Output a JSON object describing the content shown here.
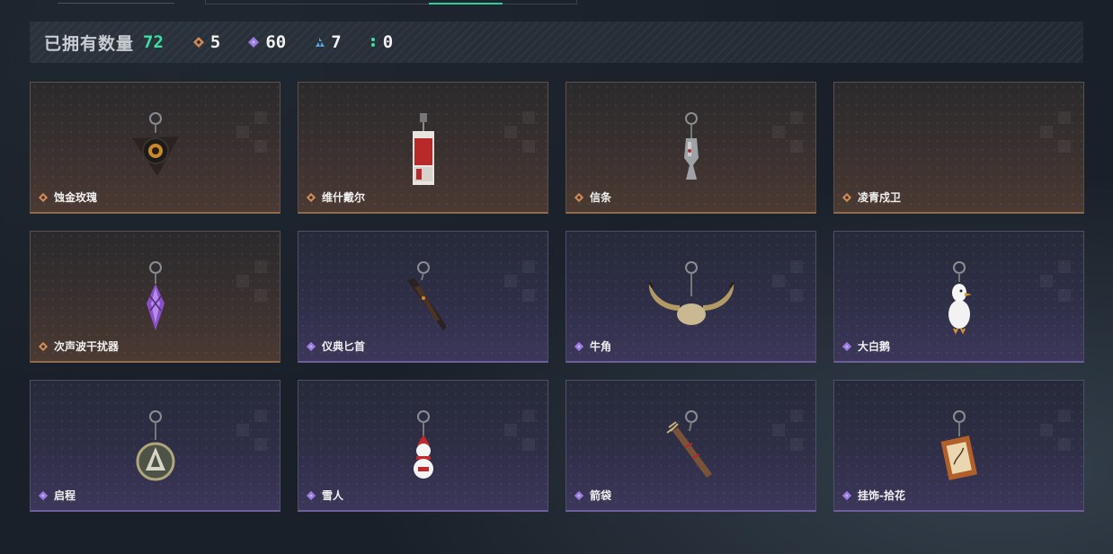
{
  "summary": {
    "owned_label": "已拥有数量",
    "owned_count": "72",
    "rarities": [
      {
        "icon": "orange-diamond-rarity-icon",
        "color": "#d08a55",
        "count": "5"
      },
      {
        "icon": "purple-diamond-rarity-icon",
        "color": "#9b7be0",
        "count": "60"
      },
      {
        "icon": "blue-triangle-rarity-icon",
        "color": "#5aa4e0",
        "count": "7"
      },
      {
        "icon": "green-dots-rarity-icon",
        "color": "#3ee0a2",
        "count": "0"
      }
    ]
  },
  "items": [
    {
      "name": "蚀金玫瑰",
      "rarity": "orange",
      "charm": "rose-charm-icon"
    },
    {
      "name": "维什戴尔",
      "rarity": "orange",
      "charm": "card-charm-icon"
    },
    {
      "name": "信条",
      "rarity": "orange",
      "charm": "creed-charm-icon"
    },
    {
      "name": "凌青戍卫",
      "rarity": "orange",
      "charm": "none"
    },
    {
      "name": "次声波干扰器",
      "rarity": "orange",
      "charm": "crystal-charm-icon"
    },
    {
      "name": "仪典匕首",
      "rarity": "purple",
      "charm": "dagger-charm-icon"
    },
    {
      "name": "牛角",
      "rarity": "purple",
      "charm": "horns-charm-icon"
    },
    {
      "name": "大白鹅",
      "rarity": "purple",
      "charm": "goose-charm-icon"
    },
    {
      "name": "启程",
      "rarity": "purple",
      "charm": "medal-charm-icon"
    },
    {
      "name": "雪人",
      "rarity": "purple",
      "charm": "snowman-charm-icon"
    },
    {
      "name": "箭袋",
      "rarity": "purple",
      "charm": "quiver-charm-icon"
    },
    {
      "name": "挂饰-拾花",
      "rarity": "purple",
      "charm": "frame-charm-icon"
    }
  ]
}
